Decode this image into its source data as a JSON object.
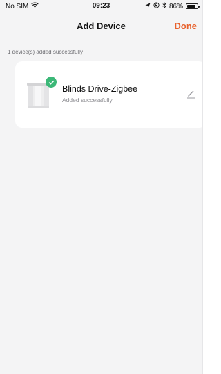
{
  "status_bar": {
    "carrier": "No SIM",
    "time": "09:23",
    "battery": "86%",
    "battery_level": 0.86,
    "icons": [
      "wifi-icon",
      "location-icon",
      "rotation-lock-icon",
      "bluetooth-icon",
      "battery-icon"
    ]
  },
  "nav": {
    "title": "Add Device",
    "done_label": "Done",
    "accent_color": "#e8612c"
  },
  "summary_text": "1 device(s) added successfully",
  "devices": [
    {
      "name": "Blinds Drive-Zigbee",
      "status": "Added successfully",
      "icon": "blinds-device-image",
      "badge": "check-icon",
      "badge_color": "#3cb878"
    }
  ]
}
